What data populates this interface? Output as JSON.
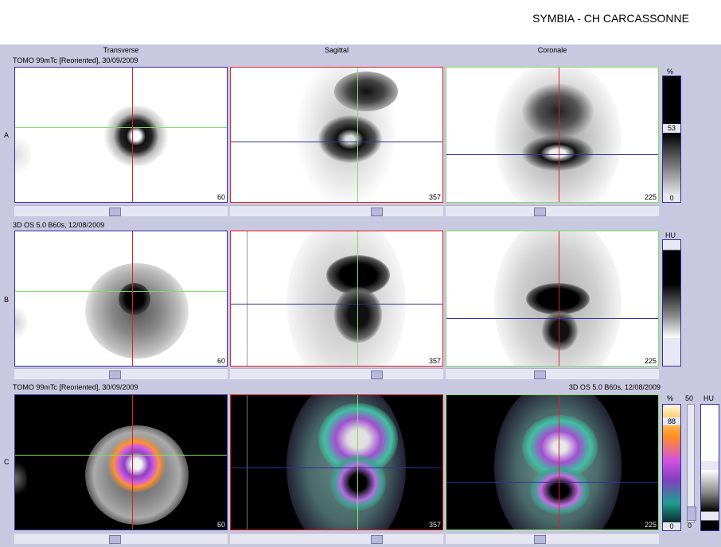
{
  "header": {
    "title": "SYMBIA - CH CARCASSONNE"
  },
  "columns": [
    "Transverse",
    "Sagittal",
    "Coronale"
  ],
  "rows": [
    {
      "letter": "A",
      "label": "TOMO 99mTc [Reoriented], 30/09/2009",
      "right_label": ""
    },
    {
      "letter": "B",
      "label": "3D  OS  5.0  B60s, 12/08/2009",
      "right_label": ""
    },
    {
      "letter": "C",
      "label": "TOMO 99mTc [Reoriented], 30/09/2009",
      "right_label": "3D  OS  5.0  B60s, 12/08/2009"
    }
  ],
  "slices": {
    "transverse": "60",
    "sagittal": "357",
    "coronale": "225"
  },
  "colorbars": {
    "a": {
      "unit": "%",
      "mid": "53",
      "min": "0"
    },
    "b": {
      "unit": "HU"
    },
    "c": {
      "unit": "%",
      "mid": "88",
      "min": "0",
      "right_top": "50",
      "right_min": "0",
      "hu_unit": "HU"
    }
  },
  "colors": {
    "workspace": "#c8c8e0",
    "crosshair_red": "#e02020",
    "crosshair_green": "#80e060",
    "crosshair_blue": "#3030a0"
  }
}
